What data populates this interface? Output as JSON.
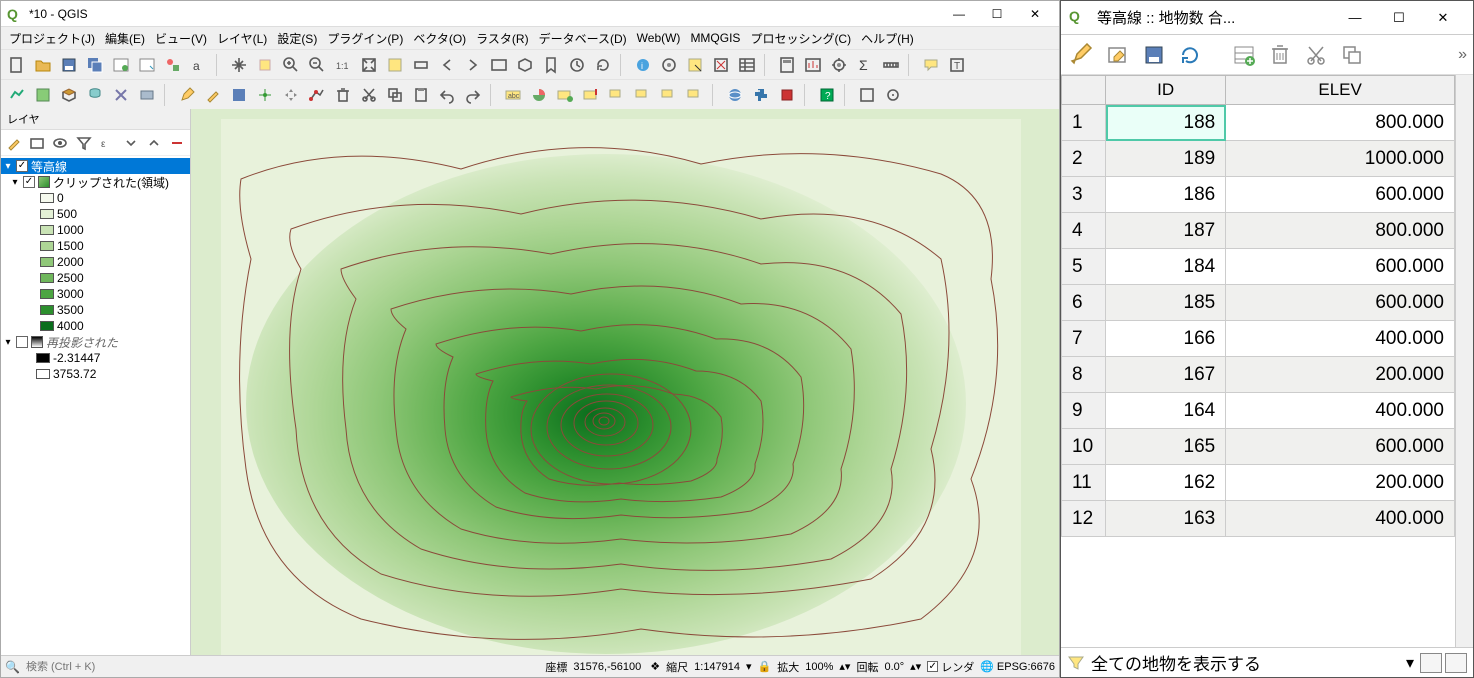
{
  "main_window": {
    "title": "*10 - QGIS",
    "menu": [
      "プロジェクト(J)",
      "編集(E)",
      "ビュー(V)",
      "レイヤ(L)",
      "設定(S)",
      "プラグイン(P)",
      "ベクタ(O)",
      "ラスタ(R)",
      "データベース(D)",
      "Web(W)",
      "MMQGIS",
      "プロセッシング(C)",
      "ヘルプ(H)"
    ],
    "layers_panel_title": "レイヤ",
    "layers": {
      "root": [
        {
          "name": "等高線",
          "checked": true,
          "selected": true,
          "expanded": true
        },
        {
          "name": "クリップされた(領域)",
          "checked": true,
          "expanded": true,
          "italic": false,
          "classes": [
            {
              "label": "0",
              "color": "#f5f9ee"
            },
            {
              "label": "500",
              "color": "#e3f0d5"
            },
            {
              "label": "1000",
              "color": "#c9e3b5"
            },
            {
              "label": "1500",
              "color": "#aed696"
            },
            {
              "label": "2000",
              "color": "#8fc778"
            },
            {
              "label": "2500",
              "color": "#6fb75c"
            },
            {
              "label": "3000",
              "color": "#4ca542"
            },
            {
              "label": "3500",
              "color": "#2c8f2e"
            },
            {
              "label": "4000",
              "color": "#0b6e1d"
            }
          ]
        },
        {
          "name": "再投影された",
          "checked": false,
          "italic": true,
          "classes": [
            {
              "label": "-2.31447",
              "color": "#000000"
            },
            {
              "label": "3753.72",
              "color": "#ffffff"
            }
          ]
        }
      ]
    },
    "statusbar": {
      "search_placeholder": "検索 (Ctrl + K)",
      "coord_label": "座標",
      "coord_value": "31576,-56100",
      "scale_label": "縮尺",
      "scale_value": "1:147914",
      "mag_label": "拡大",
      "mag_value": "100%",
      "rot_label": "回転",
      "rot_value": "0.0°",
      "render_label": "レンダ",
      "crs_label": "EPSG:6676"
    }
  },
  "attr_window": {
    "title": "等高線 :: 地物数 合...",
    "columns": [
      "ID",
      "ELEV"
    ],
    "rows": [
      {
        "n": 1,
        "id": 188,
        "elev": "800.000",
        "active": true
      },
      {
        "n": 2,
        "id": 189,
        "elev": "1000.000"
      },
      {
        "n": 3,
        "id": 186,
        "elev": "600.000"
      },
      {
        "n": 4,
        "id": 187,
        "elev": "800.000"
      },
      {
        "n": 5,
        "id": 184,
        "elev": "600.000"
      },
      {
        "n": 6,
        "id": 185,
        "elev": "600.000"
      },
      {
        "n": 7,
        "id": 166,
        "elev": "400.000"
      },
      {
        "n": 8,
        "id": 167,
        "elev": "200.000"
      },
      {
        "n": 9,
        "id": 164,
        "elev": "400.000"
      },
      {
        "n": 10,
        "id": 165,
        "elev": "600.000"
      },
      {
        "n": 11,
        "id": 162,
        "elev": "200.000"
      },
      {
        "n": 12,
        "id": 163,
        "elev": "400.000"
      }
    ],
    "footer": "全ての地物を表示する"
  }
}
